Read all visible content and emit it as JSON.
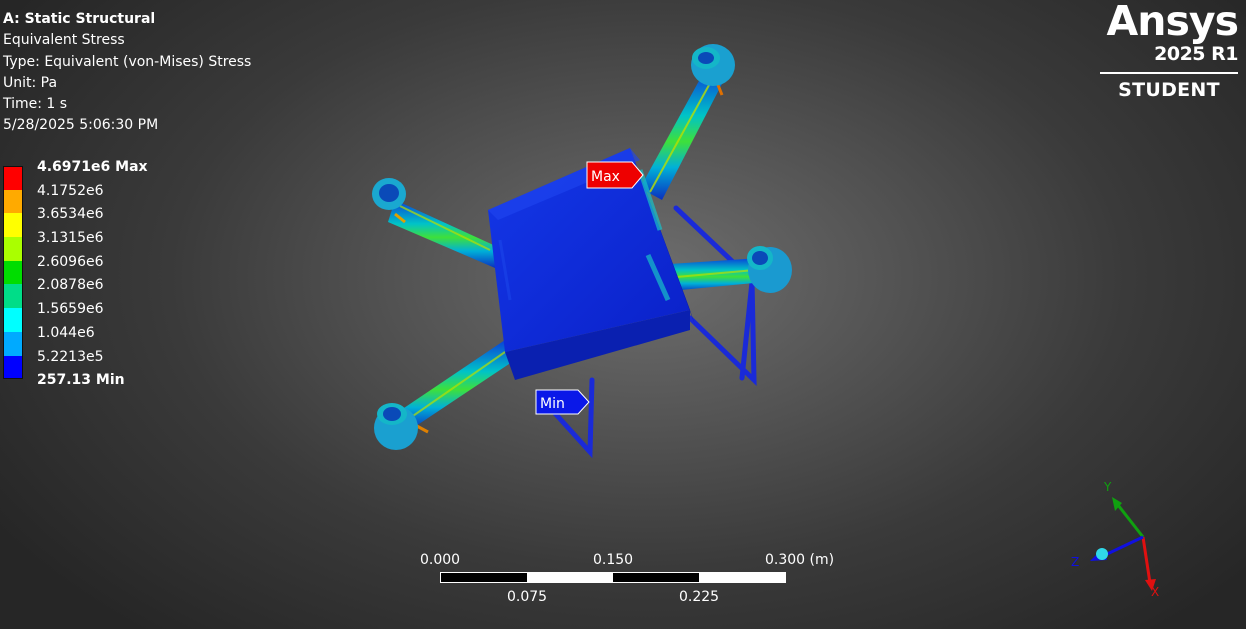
{
  "info": {
    "title": "A: Static Structural",
    "result": "Equivalent Stress",
    "type": "Type: Equivalent (von-Mises) Stress",
    "unit": "Unit: Pa",
    "time": "Time: 1 s",
    "date": "5/28/2025 5:06:30 PM"
  },
  "legend": {
    "labels": [
      "4.6971e6 Max",
      "4.1752e6",
      "3.6534e6",
      "3.1315e6",
      "2.6096e6",
      "2.0878e6",
      "1.5659e6",
      "1.044e6",
      "5.2213e5",
      "257.13 Min"
    ],
    "colors": [
      "#ff0000",
      "#ffaa00",
      "#ffff00",
      "#aaff00",
      "#00dd00",
      "#00dd88",
      "#00ffff",
      "#00aaff",
      "#0000ff"
    ]
  },
  "logo": {
    "brand": "Ansys",
    "version": "2025 R1",
    "edition": "STUDENT"
  },
  "probes": {
    "max": "Max",
    "min": "Min"
  },
  "scale_bar": {
    "tick_0": "0.000",
    "tick_1": "0.075",
    "tick_2": "0.150",
    "tick_3": "0.225",
    "tick_4": "0.300 (m)"
  },
  "triad": {
    "x": "X",
    "y": "Y",
    "z": "Z",
    "x_color": "#e01010",
    "y_color": "#10a010",
    "z_color": "#1010e0"
  }
}
